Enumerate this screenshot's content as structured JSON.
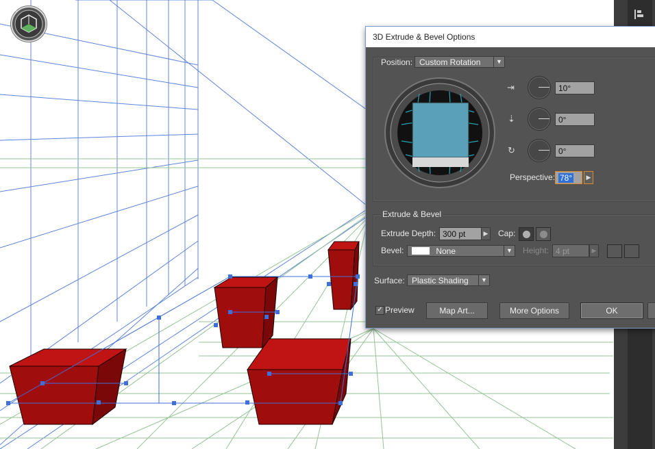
{
  "dialog": {
    "title": "3D Extrude & Bevel Options",
    "position": {
      "label": "Position:",
      "value": "Custom Rotation"
    },
    "rotation": {
      "x": "10°",
      "y": "0°",
      "z": "0°"
    },
    "axis_icons": {
      "x": "x-axis-rotate-icon",
      "y": "y-axis-rotate-icon",
      "z": "z-axis-rotate-icon"
    },
    "perspective": {
      "label": "Perspective:",
      "value": "78°"
    },
    "extrude_bevel": {
      "heading": "Extrude & Bevel",
      "depth_label": "Extrude Depth:",
      "depth_value": "300 pt",
      "cap_label": "Cap:",
      "bevel_label": "Bevel:",
      "bevel_value": "None",
      "height_label": "Height:",
      "height_value": "4 pt"
    },
    "surface": {
      "label": "Surface:",
      "value": "Plastic Shading"
    },
    "preview": {
      "label": "Preview",
      "checked": true
    },
    "buttons": {
      "map_art": "Map Art...",
      "more_options": "More Options",
      "ok": "OK"
    }
  },
  "canvas": {
    "widget_icon": "perspective-grid-widget-icon",
    "colors": {
      "blue_grid": "#3a6fd8",
      "green_grid": "#8cc08c",
      "red_object": "#a01010"
    }
  }
}
